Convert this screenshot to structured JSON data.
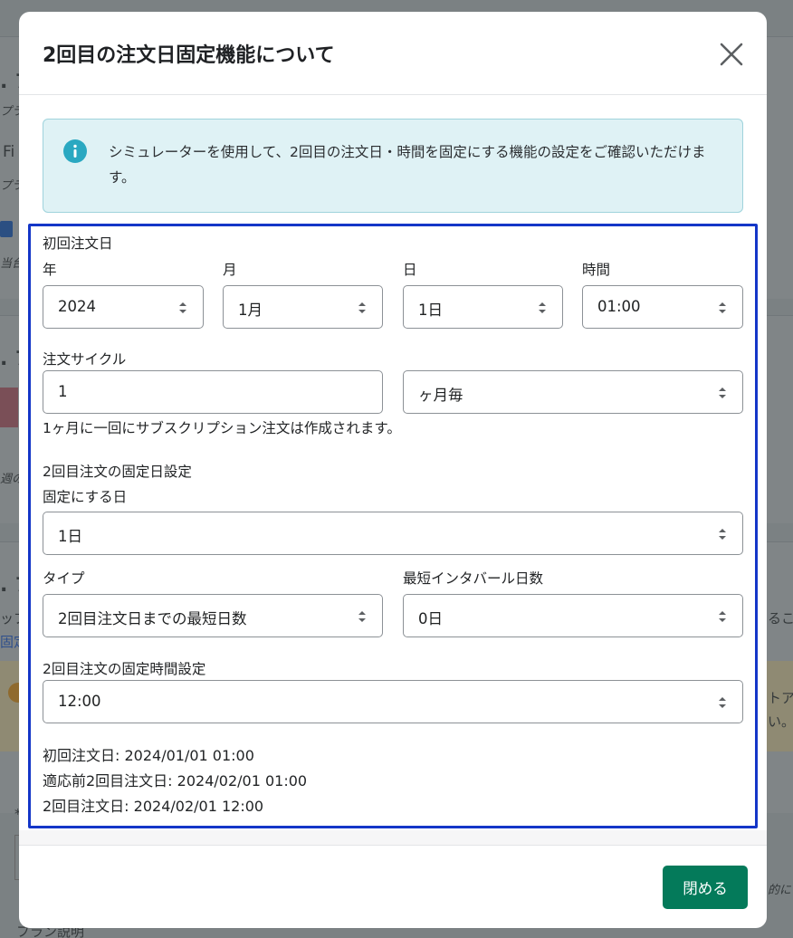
{
  "background": {
    "fragments": [
      ". ブ",
      "プラ",
      "Fi",
      "プラ",
      "当台",
      ". ブ",
      "週の",
      ". ブ",
      "ップ",
      "固定",
      "るこ",
      "トア",
      "い。",
      "*",
      "的に",
      "フラン説明"
    ]
  },
  "modal": {
    "title": "2回目の注文日固定機能について",
    "close_icon": "close-icon",
    "banner": {
      "icon": "info-icon",
      "text": "シミュレーターを使用して、2回目の注文日・時間を固定にする機能の設定をご確認いただけます。"
    },
    "first_order": {
      "section_label": "初回注文日",
      "year_label": "年",
      "month_label": "月",
      "day_label": "日",
      "time_label": "時間",
      "year_value": "2024",
      "month_value": "1月",
      "day_value": "1日",
      "time_value": "01:00"
    },
    "cycle": {
      "label": "注文サイクル",
      "count_value": "1",
      "unit_value": "ヶ月毎",
      "help": "1ヶ月に一回にサブスクリプション注文は作成されます。"
    },
    "fixed_day": {
      "section_label": "2回目注文の固定日設定",
      "day_label": "固定にする日",
      "day_value": "1日",
      "type_label": "タイプ",
      "type_value": "2回目注文日までの最短日数",
      "interval_label": "最短インタバール日数",
      "interval_value": "0日"
    },
    "fixed_time": {
      "section_label": "2回目注文の固定時間設定",
      "time_value": "12:00"
    },
    "results": {
      "first": "初回注文日: 2024/01/01 01:00",
      "before": "適応前2回目注文日: 2024/02/01 01:00",
      "second": "2回目注文日: 2024/02/01 12:00"
    },
    "footer": {
      "close_label": "閉める"
    }
  },
  "colors": {
    "primary_button": "#047a5a",
    "highlight_border": "#1436c8",
    "banner_bg": "#dff2f5",
    "info_icon": "#2aa8c1"
  }
}
